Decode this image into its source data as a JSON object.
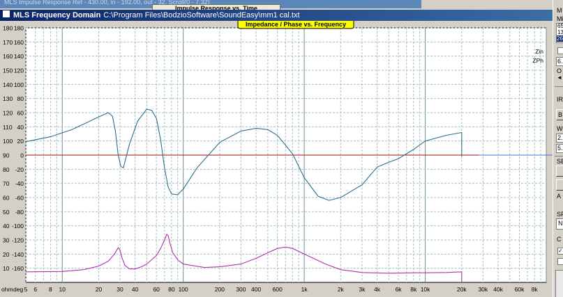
{
  "background_window": {
    "title": "MLS Impulse Response  Ref - 430.00, in - 192.00, out - 32, Scroll(0 - 7.32)",
    "tab": "Impulse Response vs. Time"
  },
  "window": {
    "title_app": "MLS Frequency Domain",
    "title_path": "C:\\Program Files\\BodzioSoftware\\SoundEasy\\mm1 cal.txt"
  },
  "chart_data": {
    "type": "line",
    "title": "Impedance / Phase vs. Frequency",
    "x_scale": "log",
    "xlim": [
      5,
      100000
    ],
    "x_tick_values": [
      5,
      6,
      8,
      10,
      20,
      30,
      40,
      60,
      80,
      100,
      200,
      300,
      400,
      600,
      1000,
      2000,
      3000,
      4000,
      6000,
      8000,
      10000,
      20000,
      30000,
      40000,
      60000,
      80000
    ],
    "x_tick_labels": [
      "5",
      "6",
      "8",
      "10",
      "20",
      "30",
      "40",
      "60",
      "80",
      "100",
      "200",
      "300",
      "400",
      "600",
      "1k",
      "2k",
      "3k",
      "4k",
      "6k",
      "8k",
      "10k",
      "20k",
      "30k",
      "40k",
      "60k",
      "8k"
    ],
    "x_unit_labels": [
      "ohm",
      "deg"
    ],
    "ohm_axis": {
      "ylim": [
        0,
        180
      ],
      "ticks": [
        "180",
        "170",
        "160",
        "150",
        "140",
        "130",
        "120",
        "110",
        "100",
        "90",
        "80",
        "70",
        "60",
        "50",
        "40",
        "30",
        "20",
        "10"
      ]
    },
    "deg_axis": {
      "ylim": [
        -180,
        180
      ],
      "ticks": [
        "180",
        "160",
        "140",
        "120",
        "100",
        "80",
        "60",
        "40",
        "20",
        "0",
        "-20",
        "-40",
        "-60",
        "-80",
        "-100",
        "-120",
        "-140",
        "-160"
      ]
    },
    "grid": true,
    "legend_position": "right",
    "reference_line": {
      "axis": "deg",
      "value": 0,
      "color": "#a01010"
    },
    "series": [
      {
        "name": "ZPh",
        "axis": "deg",
        "color": "#2c6e8e",
        "x": [
          5,
          8,
          12,
          16,
          20,
          24,
          26,
          27.5,
          29,
          30.5,
          32,
          36,
          42,
          50,
          55,
          60,
          65,
          70,
          75,
          80,
          90,
          100,
          130,
          200,
          300,
          400,
          500,
          600,
          800,
          1000,
          1300,
          1600,
          2000,
          3000,
          4000,
          5000,
          6000,
          8000,
          10000,
          15000,
          20000,
          20000
        ],
        "y": [
          19,
          26,
          36,
          46,
          54,
          60,
          55,
          34,
          0,
          -16,
          -18,
          16,
          48,
          65,
          63,
          52,
          22,
          -18,
          -45,
          -55,
          -56,
          -48,
          -18,
          18,
          34,
          38,
          36,
          28,
          2,
          -32,
          -58,
          -64,
          -60,
          -42,
          -17,
          -10,
          -5,
          8,
          20,
          28,
          32,
          -2
        ]
      },
      {
        "name": "Zin",
        "axis": "ohm",
        "color": "#b030b0",
        "x": [
          5,
          10,
          15,
          20,
          24,
          27,
          29,
          30,
          31,
          33,
          36,
          40,
          45,
          50,
          60,
          65,
          70,
          73,
          75,
          78,
          82,
          90,
          100,
          150,
          200,
          300,
          400,
          500,
          600,
          700,
          800,
          1000,
          1500,
          2000,
          3000,
          5000,
          8000,
          10000,
          15000,
          20000,
          20000
        ],
        "y": [
          7.5,
          7.7,
          9,
          11.5,
          15,
          20,
          24.5,
          23,
          18,
          12,
          9.5,
          9.5,
          11,
          13,
          19,
          24,
          30,
          34,
          33,
          27,
          21,
          16,
          13,
          10.5,
          11,
          13,
          17,
          21,
          24,
          25,
          24,
          20,
          13,
          9,
          7,
          6.5,
          6.8,
          6.8,
          7,
          7.5,
          0
        ]
      }
    ]
  },
  "right_panel": {
    "label_m": "M",
    "label_mi": "Mi",
    "field_1": "65",
    "field_2": "13",
    "field_3": "26",
    "field_4": "6.",
    "label_o": "O",
    "label_ir": "IR",
    "button_b": "B",
    "label_w": "W",
    "field_5": "2.",
    "field_6": "5.",
    "label_se": "SE",
    "label_a": "A",
    "label_sp": "SP",
    "field_7": "N",
    "label_c": "C",
    "checked_mark": "✓"
  }
}
